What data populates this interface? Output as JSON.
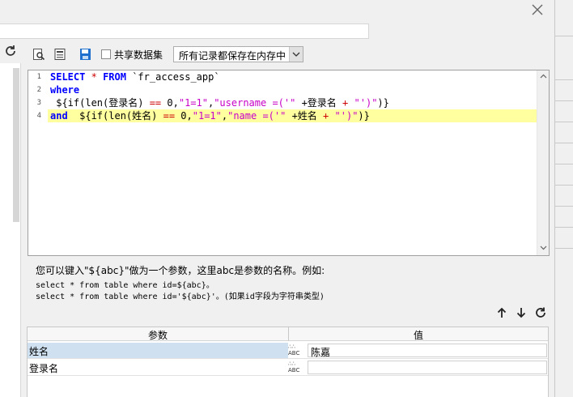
{
  "toolbar": {
    "share_dataset_label": "共享数据集",
    "memory_select_value": "所有记录都保存在内存中"
  },
  "editor": {
    "line_numbers": [
      "1",
      "2",
      "3",
      "4"
    ],
    "lines": [
      [
        {
          "t": "SELECT",
          "c": "kw"
        },
        {
          "t": " ",
          "c": "plain"
        },
        {
          "t": "*",
          "c": "op"
        },
        {
          "t": " ",
          "c": "plain"
        },
        {
          "t": "FROM",
          "c": "kw"
        },
        {
          "t": " `fr_access_app`",
          "c": "plain"
        }
      ],
      [
        {
          "t": "where",
          "c": "kw"
        }
      ],
      [
        {
          "t": " ${if(len(登录名) ",
          "c": "plain"
        },
        {
          "t": "==",
          "c": "op"
        },
        {
          "t": " 0,",
          "c": "plain"
        },
        {
          "t": "\"1=1\"",
          "c": "str"
        },
        {
          "t": ",",
          "c": "plain"
        },
        {
          "t": "\"username =('\"",
          "c": "str"
        },
        {
          "t": " +登录名 ",
          "c": "plain"
        },
        {
          "t": "+",
          "c": "op"
        },
        {
          "t": " ",
          "c": "plain"
        },
        {
          "t": "\"')\"",
          "c": "str"
        },
        {
          "t": ")}",
          "c": "plain"
        }
      ],
      [
        {
          "t": "and",
          "c": "kw"
        },
        {
          "t": "  ${if(len(姓名) ",
          "c": "plain"
        },
        {
          "t": "==",
          "c": "op"
        },
        {
          "t": " 0,",
          "c": "plain"
        },
        {
          "t": "\"1=1\"",
          "c": "str"
        },
        {
          "t": ",",
          "c": "plain"
        },
        {
          "t": "\"name =('\"",
          "c": "str"
        },
        {
          "t": " +姓名 ",
          "c": "plain"
        },
        {
          "t": "+",
          "c": "op"
        },
        {
          "t": " ",
          "c": "plain"
        },
        {
          "t": "\"')\"",
          "c": "str"
        },
        {
          "t": ")}",
          "c": "plain"
        }
      ]
    ]
  },
  "hints": {
    "line1": "您可以键入\"${abc}\"做为一个参数，这里abc是参数的名称。例如:",
    "line2": "select * from table where id=${abc}。",
    "line3": "select * from table where id='${abc}'。(如果id字段为字符串类型)"
  },
  "params": {
    "header_name": "参数",
    "header_value": "值",
    "rows": [
      {
        "name": "姓名",
        "value": "陈嘉",
        "type_icon": "ABC"
      },
      {
        "name": "登录名",
        "value": "",
        "type_icon": "ABC"
      }
    ]
  },
  "colors": {
    "keyword": "#0000ff",
    "string": "#c800c8",
    "operator": "#cc0000",
    "current_line": "#ffffa0",
    "selected_row": "#cfe0f0"
  }
}
